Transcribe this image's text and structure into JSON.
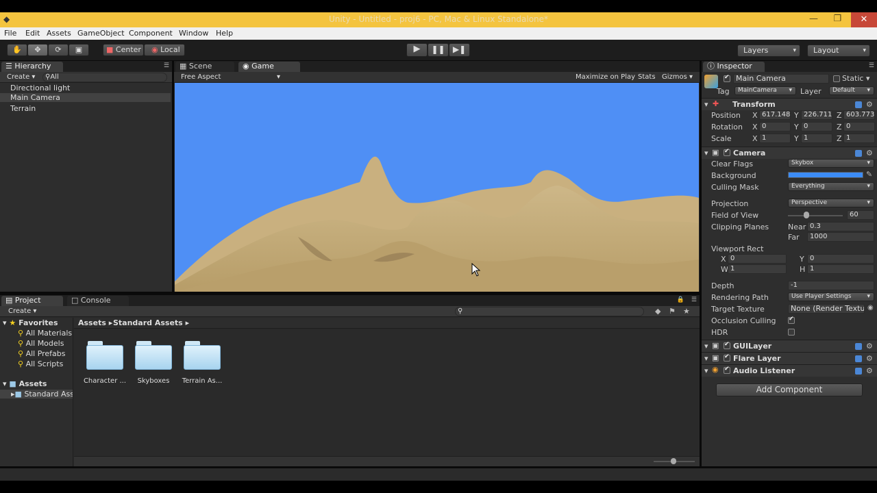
{
  "window": {
    "title": "Unity - Untitled - proj6 - PC, Mac & Linux Standalone*"
  },
  "menu": [
    "File",
    "Edit",
    "Assets",
    "GameObject",
    "Component",
    "Window",
    "Help"
  ],
  "toolbar": {
    "center_label": "Center",
    "local_label": "Local",
    "layers_label": "Layers",
    "layout_label": "Layout"
  },
  "hierarchy": {
    "tab": "Hierarchy",
    "create": "Create",
    "search_placeholder": "All",
    "items": [
      "Directional light",
      "Main Camera",
      "Terrain"
    ],
    "selected_index": 1
  },
  "scene_tabs": {
    "scene": "Scene",
    "game": "Game"
  },
  "game_bar": {
    "aspect": "Free Aspect",
    "maximize": "Maximize on Play",
    "stats": "Stats",
    "gizmos": "Gizmos"
  },
  "project": {
    "tab": "Project",
    "console_tab": "Console",
    "create": "Create",
    "favorites_label": "Favorites",
    "favorites": [
      "All Materials",
      "All Models",
      "All Prefabs",
      "All Scripts"
    ],
    "assets_label": "Assets",
    "assets_children": [
      "Standard Assets"
    ],
    "breadcrumb": [
      "Assets",
      "Standard Assets"
    ],
    "folders": [
      "Character ...",
      "Skyboxes",
      "Terrain As..."
    ]
  },
  "inspector": {
    "tab": "Inspector",
    "object_name": "Main Camera",
    "static_label": "Static",
    "tag_label": "Tag",
    "tag_value": "MainCamera",
    "layer_label": "Layer",
    "layer_value": "Default",
    "transform": {
      "title": "Transform",
      "position_label": "Position",
      "rotation_label": "Rotation",
      "scale_label": "Scale",
      "position": {
        "x": "617.148",
        "y": "226.711",
        "z": "603.773"
      },
      "rotation": {
        "x": "0",
        "y": "0",
        "z": "0"
      },
      "scale": {
        "x": "1",
        "y": "1",
        "z": "1"
      }
    },
    "camera": {
      "title": "Camera",
      "clear_flags_label": "Clear Flags",
      "clear_flags": "Skybox",
      "background_label": "Background",
      "background_color": "#3c8cf6",
      "culling_label": "Culling Mask",
      "culling": "Everything",
      "projection_label": "Projection",
      "projection": "Perspective",
      "fov_label": "Field of View",
      "fov": "60",
      "clipping_label": "Clipping Planes",
      "near_label": "Near",
      "near": "0.3",
      "far_label": "Far",
      "far": "1000",
      "viewport_label": "Viewport Rect",
      "vp_x": "0",
      "vp_y": "0",
      "vp_w": "1",
      "vp_h": "1",
      "depth_label": "Depth",
      "depth": "-1",
      "rpath_label": "Rendering Path",
      "rpath": "Use Player Settings",
      "tt_label": "Target Texture",
      "tt": "None (Render Textu",
      "occ_label": "Occlusion Culling",
      "hdr_label": "HDR",
      "occ_checked": true,
      "hdr_checked": false
    },
    "components": [
      "GUILayer",
      "Flare Layer",
      "Audio Listener"
    ],
    "add_component": "Add Component"
  },
  "colors": {
    "sky": "#4f8ff5",
    "sand": "#c9b07e"
  }
}
